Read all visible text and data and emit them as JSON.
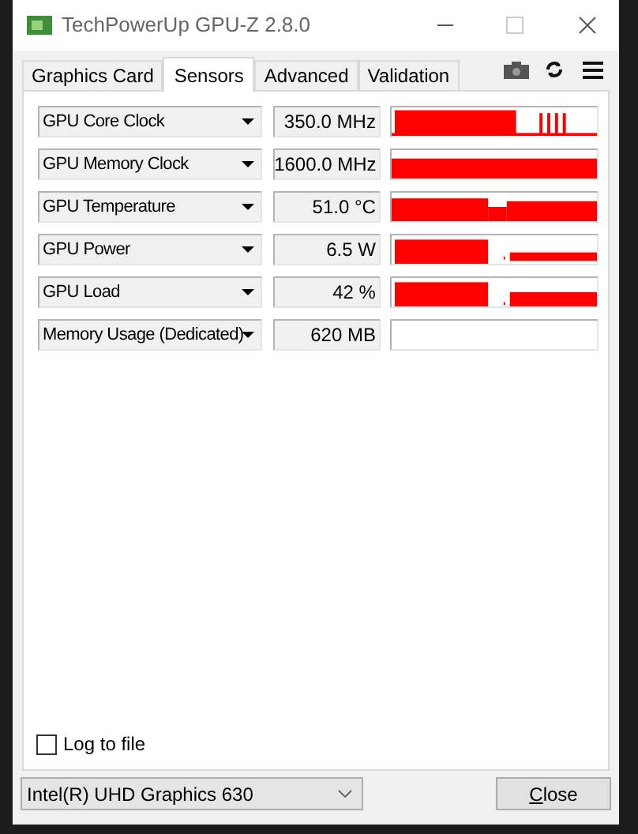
{
  "window": {
    "title": "TechPowerUp GPU-Z 2.8.0"
  },
  "tabs": [
    {
      "label": "Graphics Card",
      "selected": false
    },
    {
      "label": "Sensors",
      "selected": true
    },
    {
      "label": "Advanced",
      "selected": false
    },
    {
      "label": "Validation",
      "selected": false
    }
  ],
  "sensors": [
    {
      "name": "GPU Core Clock",
      "value": "350.0 MHz"
    },
    {
      "name": "GPU Memory Clock",
      "value": "1600.0 MHz"
    },
    {
      "name": "GPU Temperature",
      "value": "51.0 °C"
    },
    {
      "name": "GPU Power",
      "value": "6.5 W"
    },
    {
      "name": "GPU Load",
      "value": "42 %"
    },
    {
      "name": "Memory Usage (Dedicated)",
      "value": "620 MB"
    }
  ],
  "log_to_file": {
    "label": "Log to file",
    "checked": false
  },
  "device_select": {
    "value": "Intel(R) UHD Graphics 630"
  },
  "close_button": {
    "label": "Close"
  }
}
